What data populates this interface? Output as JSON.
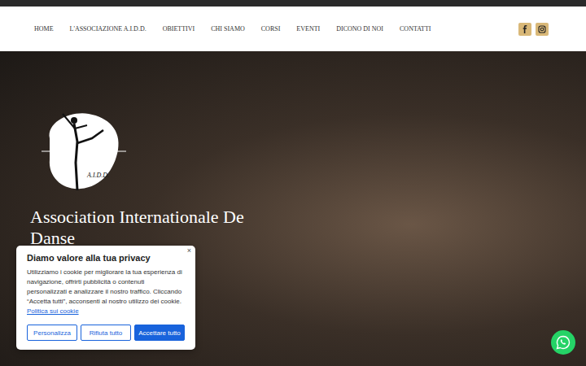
{
  "nav": {
    "items": [
      {
        "label": "HOME",
        "selected": false
      },
      {
        "label": "L'ASSOCIAZIONE A.I.D.D.",
        "selected": false
      },
      {
        "label": "OBIETTIVI",
        "selected": false
      },
      {
        "label": "CHI SIAMO",
        "selected": false
      },
      {
        "label": "CORSI",
        "selected": false
      },
      {
        "label": "EVENTI",
        "selected": false
      },
      {
        "label": "DICONO DI NOI",
        "selected": false
      },
      {
        "label": "CONTATTI",
        "selected": false
      }
    ]
  },
  "hero": {
    "logo_text": "A.I.D.D.",
    "title": "Association Internationale De Danse"
  },
  "cookie_banner": {
    "close": "×",
    "title": "Diamo valore alla tua privacy",
    "text": "Utilizziamo i cookie per migliorare la tua esperienza di navigazione, offrirti pubblicità o contenuti personalizzati e analizzare il nostro traffico. Cliccando “Accetta tutti”, acconsenti al nostro utilizzo dei cookie.",
    "link": "Politica sui cookie",
    "buttons": [
      {
        "label": "Personalizza",
        "kind": "outline"
      },
      {
        "label": "Rifiuta tutto",
        "kind": "outline"
      },
      {
        "label": "Accettare tutto",
        "kind": "filled"
      }
    ]
  }
}
